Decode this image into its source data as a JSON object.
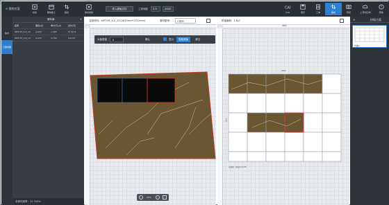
{
  "topbar": {
    "back_label": "< 我的方案",
    "tools": [
      {
        "label": "新建",
        "icon": "new-icon"
      },
      {
        "label": "删除板子",
        "icon": "delete-board-icon"
      },
      {
        "label": "裁剪",
        "icon": "crop-icon"
      },
      {
        "label": "随机排版",
        "icon": "random-layout-icon"
      }
    ],
    "import_label": "导入原板文件",
    "gap_label": "工序间距",
    "gap_value": "2.5",
    "gap_unit": "2000",
    "right_tools": [
      {
        "label": "CAD",
        "icon": "cad-icon"
      },
      {
        "label": "保存",
        "icon": "save-icon"
      },
      {
        "label": "工单",
        "icon": "order-icon"
      },
      {
        "label": "裁切",
        "icon": "cut-icon"
      },
      {
        "label": "预览",
        "icon": "preview-icon"
      },
      {
        "label": "上传到云端",
        "icon": "cloud-upload-icon"
      },
      {
        "label": "帮助",
        "icon": "help-icon"
      }
    ]
  },
  "leftrail": {
    "tabs": [
      "板材",
      "工程视图"
    ]
  },
  "leftpanel": {
    "title": "原料库",
    "columns": [
      "名称",
      "面积(㎡)",
      "单价(元/㎡)",
      "总价(元)"
    ],
    "rows": [
      [
        "WPT-95_5-2_12",
        "4.470",
        "1.283",
        "27.67.6"
      ],
      [
        "WPT-95_5-2_13",
        "4.470",
        "0.750",
        "14.747"
      ]
    ],
    "status": "总体利用率：22.344%"
  },
  "centerpanel": {
    "header": "当前材料：WPT-95_5-2_12 (2670mm*1712mm)",
    "material_label": "原材型号：",
    "material_value": "C系列",
    "toolbar": {
      "grade_label": "大板角度",
      "grade_value": "0",
      "apply_label": "确认",
      "checkbox_label": "显示",
      "action1": "智能排版",
      "action2": "清空"
    },
    "zoom_value": "25%"
  },
  "rightpanel": {
    "header": "拼接面积：1.6㎡",
    "ruler_top": "2000",
    "ruler_side": "1200",
    "caption": "效果图：拼接尺寸(CM)"
  },
  "farright": {
    "title": "拼接方案",
    "thumb_label": "方案1"
  },
  "colors": {
    "accent": "#2f7fd0",
    "selection": "#e0312f",
    "marble": "#6a5630"
  }
}
